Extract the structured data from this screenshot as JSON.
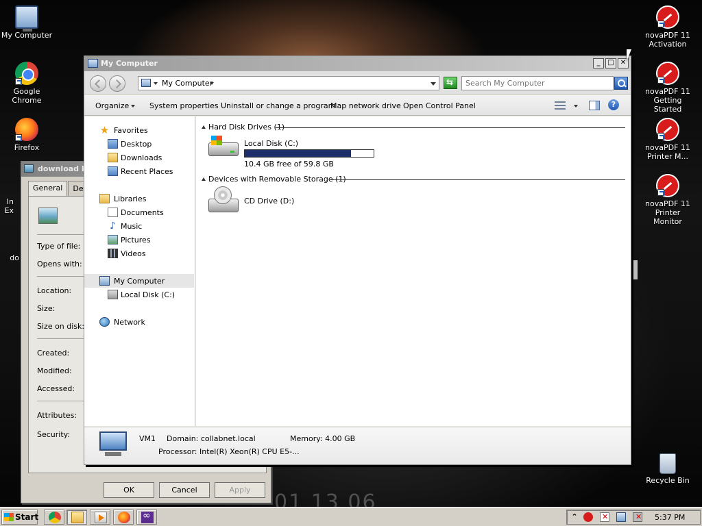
{
  "desktop": {
    "icons": [
      {
        "label": "My Computer",
        "icon": "my-computer-icon"
      },
      {
        "label": "Google Chrome",
        "icon": "chrome-icon"
      },
      {
        "label": "Firefox",
        "icon": "firefox-icon"
      },
      {
        "label": "novaPDF 11 Activation",
        "icon": "novapdf-icon"
      },
      {
        "label": "novaPDF 11 Getting Started",
        "icon": "novapdf-icon"
      },
      {
        "label": "novaPDF 11 Printer M...",
        "icon": "novapdf-icon"
      },
      {
        "label": "novaPDF 11 Printer Monitor",
        "icon": "novapdf-icon"
      },
      {
        "label": "Recycle Bin",
        "icon": "recycle-bin-icon"
      }
    ],
    "partial_labels": [
      "In",
      "Ex",
      "do"
    ]
  },
  "properties_dialog": {
    "title": "download Pr",
    "tabs": [
      "General",
      "Detail"
    ],
    "fields": [
      "Type of file:",
      "Opens with:",
      "Location:",
      "Size:",
      "Size on disk:",
      "Created:",
      "Modified:",
      "Accessed:",
      "Attributes:",
      "Security:"
    ],
    "buttons": {
      "ok": "OK",
      "cancel": "Cancel",
      "apply": "Apply"
    }
  },
  "explorer": {
    "title": "My Computer",
    "address": "My Computer",
    "search_placeholder": "Search My Computer",
    "toolbar": {
      "organize": "Organize",
      "system_properties": "System properties",
      "uninstall": "Uninstall or change a program",
      "map_drive": "Map network drive",
      "control_panel": "Open Control Panel",
      "help": "?"
    },
    "nav": {
      "favorites": "Favorites",
      "desktop": "Desktop",
      "downloads": "Downloads",
      "recent": "Recent Places",
      "libraries": "Libraries",
      "documents": "Documents",
      "music": "Music",
      "pictures": "Pictures",
      "videos": "Videos",
      "my_computer": "My Computer",
      "local_disk": "Local Disk (C:)",
      "network": "Network"
    },
    "groups": {
      "hard_disk": "Hard Disk Drives (1)",
      "removable": "Devices with Removable Storage (1)"
    },
    "drives": {
      "c_name": "Local Disk (C:)",
      "c_free": "10.4 GB free of 59.8 GB",
      "c_used_fraction": 0.826,
      "d_name": "CD Drive (D:)"
    },
    "details": {
      "computer_name": "VM1",
      "domain": "Domain: collabnet.local",
      "memory": "Memory: 4.00 GB",
      "processor": "Processor: Intel(R) Xeon(R) CPU E5-..."
    }
  },
  "taskbar": {
    "start": "Start",
    "clock": "5:37 PM",
    "tray_up": "⌃"
  },
  "wallpaper_text": "01 13 06",
  "colors": {
    "usage_fill": "#1c2f6b",
    "selection": "#e6e6e6"
  }
}
